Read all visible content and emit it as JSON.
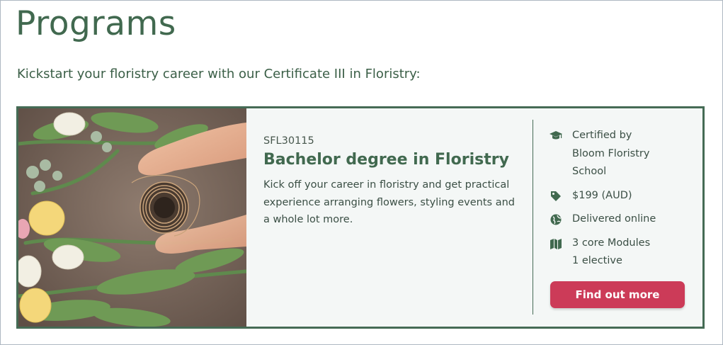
{
  "page": {
    "title": "Programs",
    "intro": "Kickstart your floristry career with our Certificate III in Floristry:"
  },
  "program_card": {
    "image_subject": "hands holding a spool of twine among tulips and eucalyptus",
    "code": "SFL30115",
    "title": "Bachelor degree in Floristry",
    "description": "Kick off your career in floristry and get practical experience arranging flowers, styling events and a whole lot more.",
    "details": [
      {
        "icon": "graduation-cap-icon",
        "lines": [
          "Certified by",
          "Bloom Floristry",
          "School"
        ]
      },
      {
        "icon": "price-tag-icon",
        "lines": [
          "$199 (AUD)"
        ]
      },
      {
        "icon": "globe-icon",
        "lines": [
          "Delivered online"
        ]
      },
      {
        "icon": "map-icon",
        "lines": [
          "3 core Modules",
          "1 elective"
        ]
      }
    ],
    "cta_label": "Find out more"
  },
  "colors": {
    "brand_green": "#41694f",
    "card_border": "#456b55",
    "card_background": "#f4f7f6",
    "cta_background": "#cc3b58",
    "cta_text": "#ffffff"
  }
}
